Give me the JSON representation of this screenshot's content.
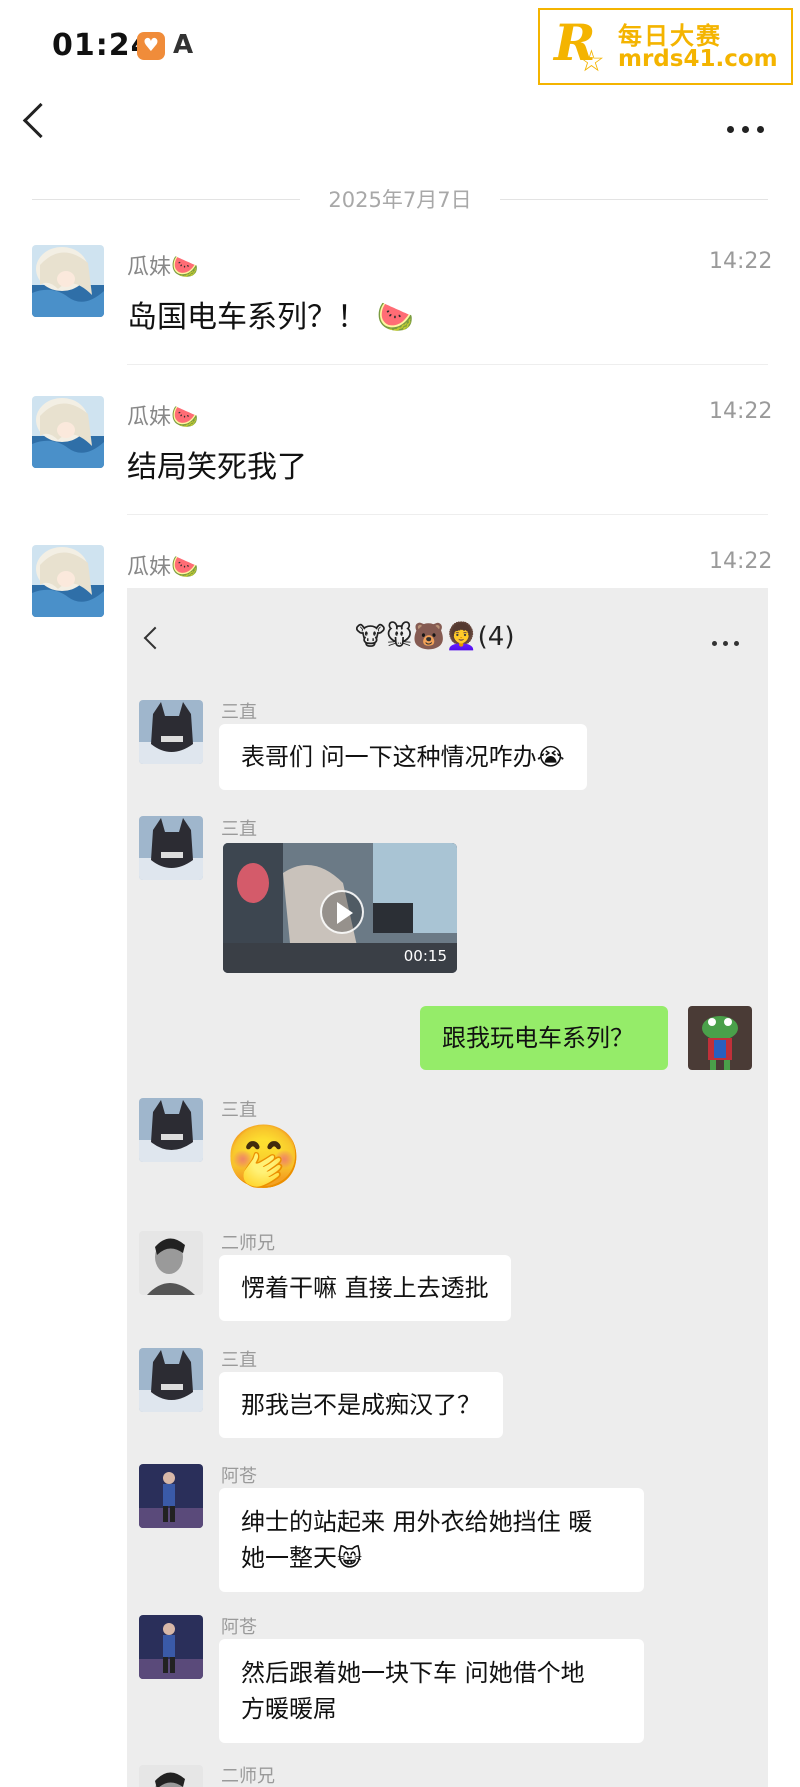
{
  "status_bar": {
    "time": "01:24"
  },
  "watermark": {
    "line1": "每日大赛",
    "line2": "mrds41.com"
  },
  "chat": {
    "date_divider": "2025年7月7日",
    "messages": [
      {
        "sender": "瓜妹🍉",
        "time": "14:22",
        "text": "岛国电车系列？！ 🍉"
      },
      {
        "sender": "瓜妹🍉",
        "time": "14:22",
        "text": "结局笑死我了"
      },
      {
        "sender": "瓜妹🍉",
        "time": "14:22",
        "text": ""
      }
    ]
  },
  "embedded_chat": {
    "title": "🐮🐭🐻👩‍🦱(4)",
    "messages": [
      {
        "sender": "三直",
        "text": "表哥们 问一下这种情况咋办😭"
      },
      {
        "sender": "三直",
        "video_duration": "00:15"
      },
      {
        "self": true,
        "text": "跟我玩电车系列？"
      },
      {
        "sender": "三直",
        "emoji": "🤭"
      },
      {
        "sender": "二师兄",
        "text": "愣着干嘛 直接上去透批"
      },
      {
        "sender": "三直",
        "text": "那我岂不是成痴汉了？"
      },
      {
        "sender": "阿苍",
        "line1": "绅士的站起来 用外衣给她挡住 暖",
        "line2": "她一整天😸"
      },
      {
        "sender": "阿苍",
        "line1": "然后跟着她一块下车 问她借个地",
        "line2": "方暖暖屌"
      },
      {
        "sender": "二师兄"
      }
    ]
  }
}
